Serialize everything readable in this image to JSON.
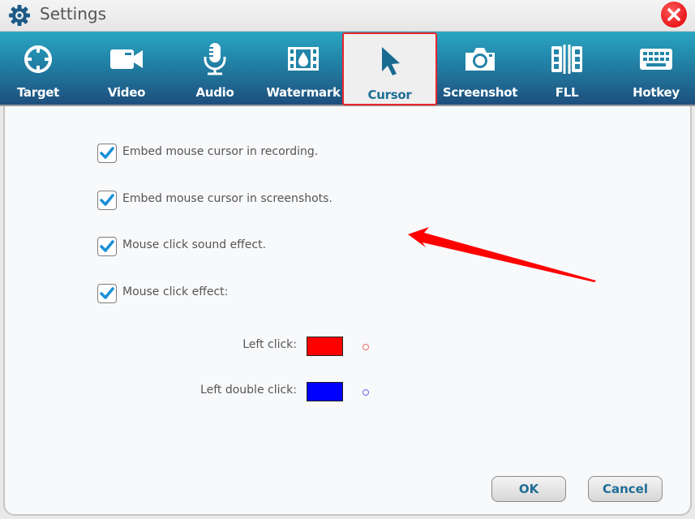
{
  "window": {
    "title": "Settings",
    "title_icon": "gear-icon",
    "close_icon": "close-icon"
  },
  "tabs": [
    {
      "label": "Target",
      "icon": "crosshair-icon",
      "active": false
    },
    {
      "label": "Video",
      "icon": "video-camera-icon",
      "active": false
    },
    {
      "label": "Audio",
      "icon": "microphone-icon",
      "active": false
    },
    {
      "label": "Watermark",
      "icon": "watermark-film-icon",
      "active": false
    },
    {
      "label": "Cursor",
      "icon": "cursor-arrow-icon",
      "active": true
    },
    {
      "label": "Screenshot",
      "icon": "camera-icon",
      "active": false
    },
    {
      "label": "FLL",
      "icon": "film-split-icon",
      "active": false
    },
    {
      "label": "Hotkey",
      "icon": "keyboard-icon",
      "active": false
    }
  ],
  "options": [
    {
      "label": "Embed mouse cursor in recording.",
      "checked": true
    },
    {
      "label": "Embed mouse cursor in screenshots.",
      "checked": true
    },
    {
      "label": "Mouse click sound effect.",
      "checked": true
    },
    {
      "label": "Mouse click effect:",
      "checked": true
    }
  ],
  "click_colors": [
    {
      "label": "Left click:",
      "color": "#ff0000",
      "preview_color": "#f06a6a"
    },
    {
      "label": "Left double click:",
      "color": "#0000ff",
      "preview_color": "#6a6af0"
    }
  ],
  "buttons": {
    "ok": "OK",
    "cancel": "Cancel"
  },
  "colors": {
    "accent": "#1f6e96",
    "highlight": "#e8262b",
    "annotation_arrow": "#ff0000"
  }
}
